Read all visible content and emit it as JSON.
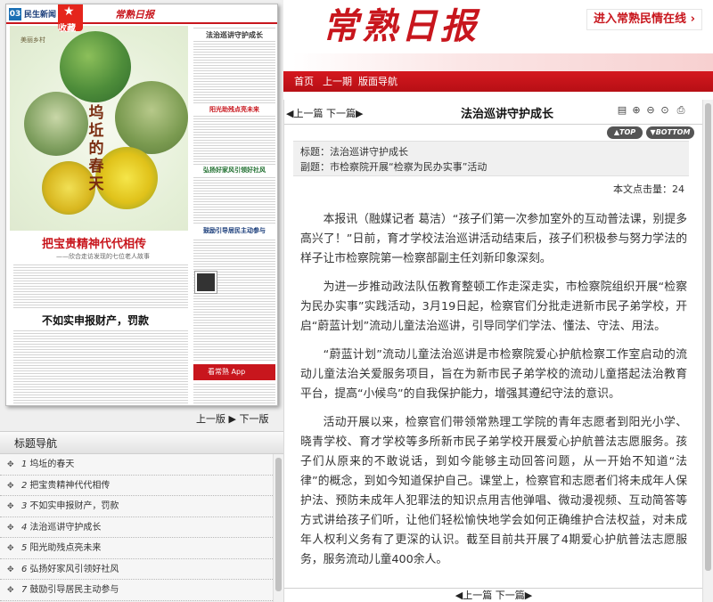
{
  "paper_page": {
    "page_number": "03",
    "page_name": "民生新闻",
    "logo": "常熟日报",
    "favorite_label": "收藏",
    "spring_title": "坞坵的春天",
    "spring_subtitle": "美丽乡村",
    "headline_column": "法治巡讲守护成长",
    "headline_2": "阳光助残点亮未来",
    "headline_3": "弘扬好家风引领好社风",
    "headline_4": "鼓励引导居民主动参与",
    "treasure_title": "把宝贵精神代代相传",
    "treasure_subtitle": "——欣合走访发现的七位老人故事",
    "declare_title": "不如实申报财产，罚款",
    "app_label": "看常熟 App"
  },
  "page_nav": {
    "prev": "上一版",
    "next": "下一版"
  },
  "topics": {
    "header": "标题导航",
    "items": [
      {
        "num": "1",
        "title": "坞坵的春天"
      },
      {
        "num": "2",
        "title": "把宝贵精神代代相传"
      },
      {
        "num": "3",
        "title": "不如实申报财产，罚款"
      },
      {
        "num": "4",
        "title": "法治巡讲守护成长"
      },
      {
        "num": "5",
        "title": "阳光助残点亮未来"
      },
      {
        "num": "6",
        "title": "弘扬好家风引领好社风"
      },
      {
        "num": "7",
        "title": "鼓励引导居民主动参与"
      }
    ]
  },
  "header": {
    "masthead": "常熟日报",
    "link": "进入常熟民情在线 ›"
  },
  "nav": {
    "home": "首页",
    "prev_issue": "上一期",
    "page_nav": "版面导航"
  },
  "toolbar": {
    "prev": "上一篇",
    "next": "下一篇",
    "title": "法治巡讲守护成长",
    "top": "TOP",
    "bottom": "BOTTOM"
  },
  "meta": {
    "title_label": "标题：",
    "title_value": "法治巡讲守护成长",
    "subtitle_label": "副题：",
    "subtitle_value": "市检察院开展“检察为民办实事”活动",
    "hits_label": "本文点击量：",
    "hits_value": "24"
  },
  "article": {
    "p1": "本报讯（融媒记者 葛洁）“孩子们第一次参加室外的互动普法课，别提多高兴了！”日前，育才学校法治巡讲活动结束后，孩子们积极参与努力学法的样子让市检察院第一检察部副主任刘新印象深刻。",
    "p2": "为进一步推动政法队伍教育整顿工作走深走实，市检察院组织开展“检察为民办实事”实践活动，3月19日起，检察官们分批走进新市民子弟学校，开启“蔚蓝计划”流动儿童法治巡讲，引导同学们学法、懂法、守法、用法。",
    "p3": "“蔚蓝计划”流动儿童法治巡讲是市检察院爱心护航检察工作室启动的流动儿童法治关爱服务项目，旨在为新市民子弟学校的流动儿童搭起法治教育平台，提高“小候鸟”的自我保护能力，增强其遵纪守法的意识。",
    "p4": "活动开展以来，检察官们带领常熟理工学院的青年志愿者到阳光小学、晓青学校、育才学校等多所新市民子弟学校开展爱心护航普法志愿服务。孩子们从原来的不敢说话，到如今能够主动回答问题，从一开始不知道“法律”的概念，到如今知道保护自己。课堂上，检察官和志愿者们将未成年人保护法、预防未成年人犯罪法的知识点用吉他弹唱、微动漫视频、互动简答等方式讲给孩子们听，让他们轻松愉快地学会如何正确维护合法权益，对未成年人权利义务有了更深的认识。截至目前共开展了4期爱心护航普法志愿服务，服务流动儿童400余人。"
  },
  "bottom_nav": {
    "prev": "上一篇",
    "next": "下一篇"
  }
}
